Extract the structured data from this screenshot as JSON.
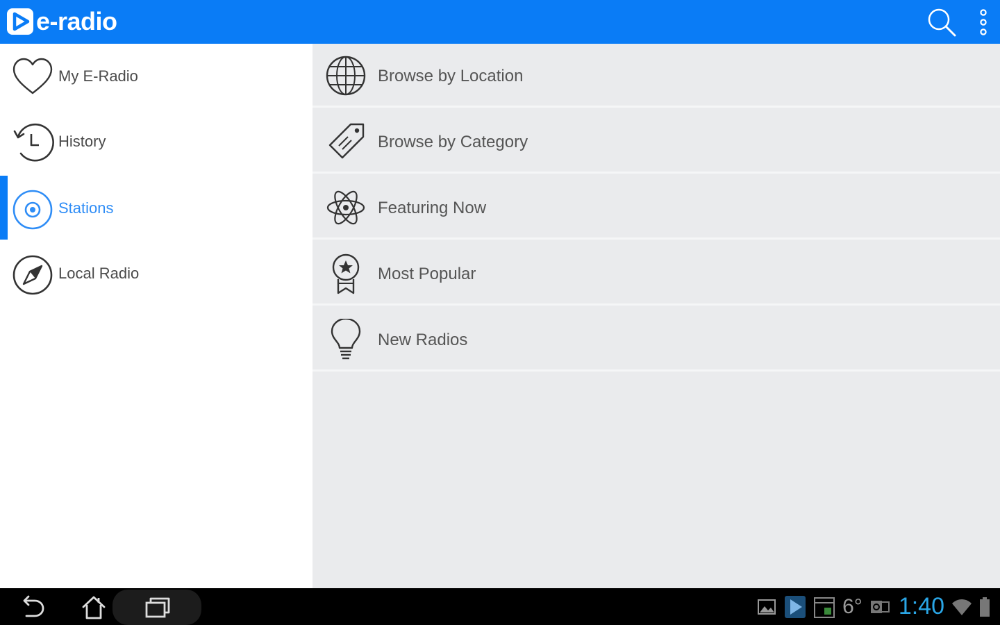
{
  "app": {
    "name": "e-radio",
    "accent_color": "#0a7cf6",
    "active_color": "#2f8df6"
  },
  "toolbar": {
    "search_icon": "search-icon",
    "overflow_icon": "overflow-menu-icon"
  },
  "sidebar": {
    "items": [
      {
        "label": "My E-Radio",
        "icon": "heart-icon",
        "active": false
      },
      {
        "label": "History",
        "icon": "history-icon",
        "active": false
      },
      {
        "label": "Stations",
        "icon": "radio-target-icon",
        "active": true
      },
      {
        "label": "Local Radio",
        "icon": "compass-icon",
        "active": false
      }
    ]
  },
  "main": {
    "rows": [
      {
        "label": "Browse by Location",
        "icon": "globe-icon"
      },
      {
        "label": "Browse by Category",
        "icon": "tag-icon"
      },
      {
        "label": "Featuring Now",
        "icon": "atom-icon"
      },
      {
        "label": "Most Popular",
        "icon": "award-ribbon-icon"
      },
      {
        "label": "New Radios",
        "icon": "lightbulb-icon"
      }
    ]
  },
  "system_bar": {
    "temperature": "6°",
    "time": "1:40",
    "nav_icons": [
      "back-icon",
      "home-icon",
      "recent-apps-icon"
    ],
    "status_icons": [
      "gallery-notification-icon",
      "play-store-icon",
      "calendar-icon",
      "weather-icon",
      "outlook-icon",
      "wifi-icon",
      "battery-icon"
    ]
  }
}
